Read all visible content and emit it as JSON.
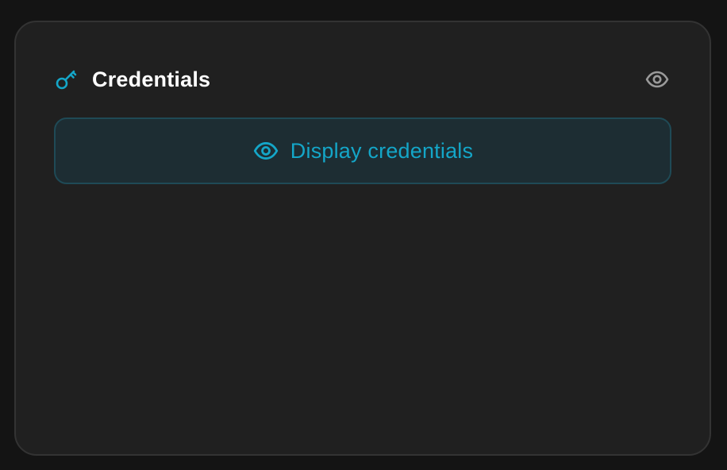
{
  "card": {
    "title": "Credentials",
    "title_icon": "key-icon",
    "header_action_icon": "eye-icon",
    "display_button": {
      "label": "Display credentials",
      "icon": "eye-icon"
    }
  },
  "colors": {
    "accent": "#14a6c8",
    "card_background": "#202020",
    "page_background": "#141414",
    "button_background": "#1d2d33",
    "button_border": "#1f4a56",
    "header_icon": "#9a9a9a"
  }
}
